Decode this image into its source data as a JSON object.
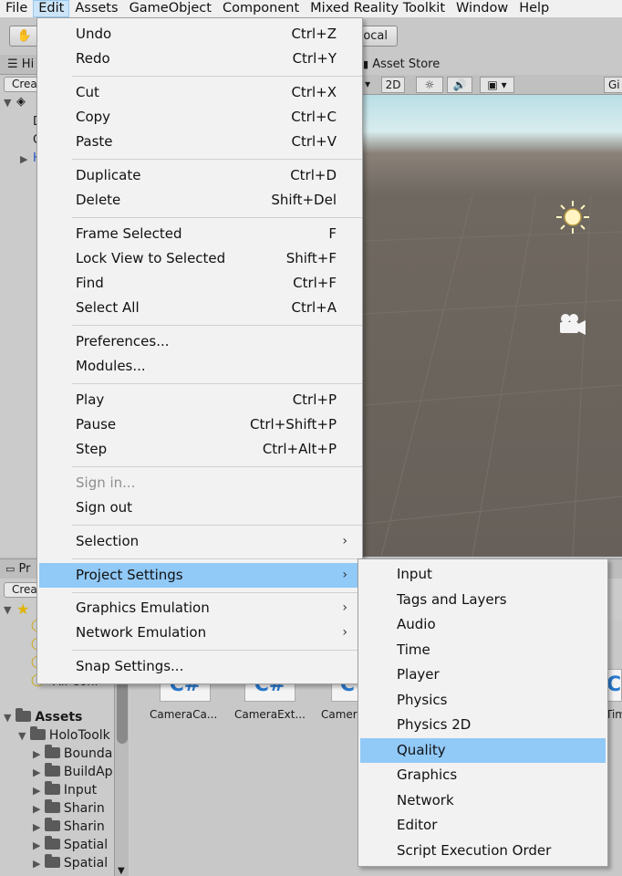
{
  "menubar": {
    "items": [
      "File",
      "Edit",
      "Assets",
      "GameObject",
      "Component",
      "Mixed Reality Toolkit",
      "Window",
      "Help"
    ],
    "active": "Edit"
  },
  "toolbar": {
    "local_label": "ocal"
  },
  "hierarchy": {
    "tab": "Hi",
    "create": "Crea",
    "items": [
      "D",
      "C",
      "H"
    ]
  },
  "scene": {
    "asset_store_tab": "Asset Store",
    "btn_2d": "2D",
    "gizmos": "Gi"
  },
  "project": {
    "tab": "Pr",
    "create": "Crea",
    "favorites_all": "All Conf",
    "assets_label": "Assets",
    "tree": [
      "HoloToolk",
      "Bounda",
      "BuildAp",
      "Input",
      "Sharin",
      "Sharin",
      "Spatial",
      "Spatial"
    ],
    "files": [
      "CameraCa...",
      "CameraExt...",
      "Camer",
      "Tim"
    ]
  },
  "edit_menu": {
    "groups": [
      [
        {
          "label": "Undo",
          "shortcut": "Ctrl+Z"
        },
        {
          "label": "Redo",
          "shortcut": "Ctrl+Y"
        }
      ],
      [
        {
          "label": "Cut",
          "shortcut": "Ctrl+X"
        },
        {
          "label": "Copy",
          "shortcut": "Ctrl+C"
        },
        {
          "label": "Paste",
          "shortcut": "Ctrl+V"
        }
      ],
      [
        {
          "label": "Duplicate",
          "shortcut": "Ctrl+D"
        },
        {
          "label": "Delete",
          "shortcut": "Shift+Del"
        }
      ],
      [
        {
          "label": "Frame Selected",
          "shortcut": "F"
        },
        {
          "label": "Lock View to Selected",
          "shortcut": "Shift+F"
        },
        {
          "label": "Find",
          "shortcut": "Ctrl+F"
        },
        {
          "label": "Select All",
          "shortcut": "Ctrl+A"
        }
      ],
      [
        {
          "label": "Preferences...",
          "shortcut": ""
        },
        {
          "label": "Modules...",
          "shortcut": ""
        }
      ],
      [
        {
          "label": "Play",
          "shortcut": "Ctrl+P"
        },
        {
          "label": "Pause",
          "shortcut": "Ctrl+Shift+P"
        },
        {
          "label": "Step",
          "shortcut": "Ctrl+Alt+P"
        }
      ],
      [
        {
          "label": "Sign in...",
          "shortcut": "",
          "disabled": true
        },
        {
          "label": "Sign out",
          "shortcut": ""
        }
      ],
      [
        {
          "label": "Selection",
          "shortcut": "",
          "submenu": true
        }
      ],
      [
        {
          "label": "Project Settings",
          "shortcut": "",
          "submenu": true,
          "highlighted": true
        }
      ],
      [
        {
          "label": "Graphics Emulation",
          "shortcut": "",
          "submenu": true
        },
        {
          "label": "Network Emulation",
          "shortcut": "",
          "submenu": true
        }
      ],
      [
        {
          "label": "Snap Settings...",
          "shortcut": ""
        }
      ]
    ]
  },
  "project_settings_submenu": {
    "items": [
      "Input",
      "Tags and Layers",
      "Audio",
      "Time",
      "Player",
      "Physics",
      "Physics 2D",
      "Quality",
      "Graphics",
      "Network",
      "Editor",
      "Script Execution Order"
    ],
    "highlighted": "Quality"
  },
  "colors": {
    "menu_bg": "#f2f2f2",
    "highlight": "#91c9f7",
    "menubar_active": "#cce4f7",
    "disabled_text": "#8f8f8f"
  }
}
